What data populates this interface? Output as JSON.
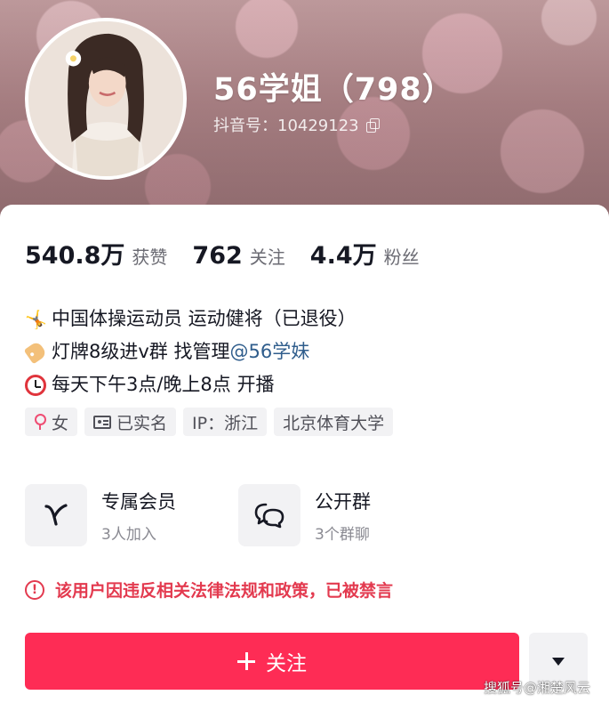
{
  "profile": {
    "nickname": "56学姐（798）",
    "douyin_id": "抖音号：10429123"
  },
  "stats": [
    {
      "value": "540.8万",
      "label": "获赞"
    },
    {
      "value": "762",
      "label": "关注"
    },
    {
      "value": "4.4万",
      "label": "粉丝"
    }
  ],
  "bio": {
    "line1": "中国体操运动员 运动健将（已退役）",
    "line2_prefix": "灯牌8级进v群 找管理",
    "line2_mention": "@56学妹",
    "line3": "每天下午3点/晚上8点 开播"
  },
  "tags": {
    "gender": "女",
    "verified": "已实名",
    "ip": "IP：浙江",
    "school": "北京体育大学"
  },
  "features": [
    {
      "title": "专属会员",
      "sub": "3人加入",
      "icon": "v-icon"
    },
    {
      "title": "公开群",
      "sub": "3个群聊",
      "icon": "chat-bubbles-icon"
    }
  ],
  "warning": {
    "icon_glyph": "!",
    "text": "该用户因违反相关法律法规和政策，已被禁言"
  },
  "actions": {
    "follow_label": "关注"
  },
  "watermark": "搜狐号@湘楚风云",
  "colors": {
    "accent": "#fe2c55",
    "warning": "#e33a4f",
    "mention": "#2f5d8c"
  }
}
